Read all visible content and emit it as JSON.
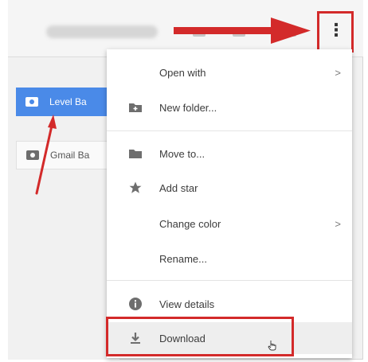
{
  "toolbar": {
    "more_icon_glyph": "⋮"
  },
  "sidebar": {
    "folders": [
      {
        "label": "Level Ba",
        "selected": true
      },
      {
        "label": "Gmail Ba",
        "selected": false
      }
    ]
  },
  "context_menu": {
    "items": [
      {
        "label": "Open with",
        "icon": "",
        "submenu_indicator": ">"
      },
      {
        "label": "New folder...",
        "icon": "new-folder-icon"
      },
      {
        "label": "Move to...",
        "icon": "folder-icon"
      },
      {
        "label": "Add star",
        "icon": "star-icon"
      },
      {
        "label": "Change color",
        "icon": "",
        "submenu_indicator": ">"
      },
      {
        "label": "Rename...",
        "icon": ""
      },
      {
        "label": "View details",
        "icon": "info-icon"
      },
      {
        "label": "Download",
        "icon": "download-icon",
        "hovered": true
      }
    ]
  },
  "annotation_colors": {
    "highlight": "#d32a2a",
    "selected_folder": "#4a8ae8"
  }
}
